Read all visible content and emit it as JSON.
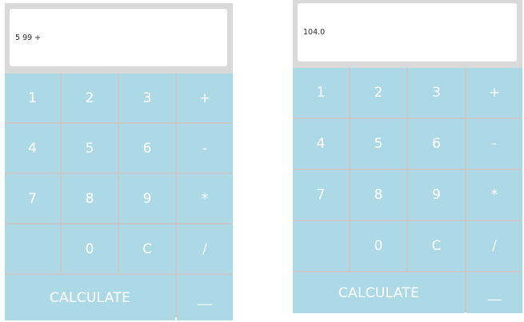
{
  "calculators": [
    {
      "display": "5 99 +",
      "keys": [
        "1",
        "2",
        "3",
        "+",
        "4",
        "5",
        "6",
        "-",
        "7",
        "8",
        "9",
        "*",
        "",
        "0",
        "C",
        "/"
      ],
      "calculate_label": "CALCULATE",
      "backspace_label": "__"
    },
    {
      "display": "104.0",
      "keys": [
        "1",
        "2",
        "3",
        "+",
        "4",
        "5",
        "6",
        "-",
        "7",
        "8",
        "9",
        "*",
        "",
        "0",
        "C",
        "/"
      ],
      "calculate_label": "CALCULATE",
      "backspace_label": "__"
    }
  ],
  "colors": {
    "key_bg": "#add8e6",
    "frame_bg": "#d9d9d9",
    "display_bg": "#ffffff",
    "key_text": "#ffffff"
  }
}
